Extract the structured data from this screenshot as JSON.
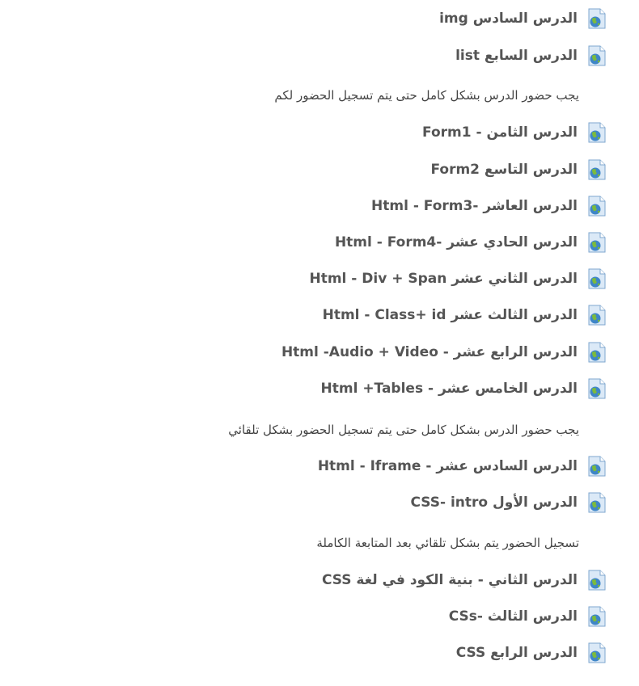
{
  "course": {
    "activities": [
      {
        "type": "url",
        "icon": "url-globe-icon",
        "title": "الدرس السادس img"
      },
      {
        "type": "url",
        "icon": "url-globe-icon",
        "title": "الدرس السابع list"
      },
      {
        "type": "label",
        "text": "يجب حضور الدرس بشكل كامل حتى يتم تسجيل الحضور لكم"
      },
      {
        "type": "url",
        "icon": "url-globe-icon",
        "title": "الدرس الثامن - Form1"
      },
      {
        "type": "url",
        "icon": "url-globe-icon",
        "title": "الدرس التاسع Form2"
      },
      {
        "type": "url",
        "icon": "url-globe-icon",
        "title": "الدرس العاشر -Html - Form3"
      },
      {
        "type": "url",
        "icon": "url-globe-icon",
        "title": "الدرس الحادي عشر -Html - Form4"
      },
      {
        "type": "url",
        "icon": "url-globe-icon",
        "title": "الدرس الثاني عشر Html - Div + Span"
      },
      {
        "type": "url",
        "icon": "url-globe-icon",
        "title": "الدرس الثالث عشر Html - Class+ id"
      },
      {
        "type": "url",
        "icon": "url-globe-icon",
        "title": "الدرس الرابع عشر - Html -Audio + Video"
      },
      {
        "type": "url",
        "icon": "url-globe-icon",
        "title": "الدرس الخامس عشر - Html +Tables"
      },
      {
        "type": "label",
        "text": "يجب حضور الدرس بشكل كامل حتى يتم تسجيل الحضور بشكل تلقائي"
      },
      {
        "type": "url",
        "icon": "url-globe-icon",
        "title": "الدرس السادس عشر - Html - Iframe"
      },
      {
        "type": "url",
        "icon": "url-globe-icon",
        "title": "الدرس الأول CSS- intro"
      },
      {
        "type": "label",
        "text": "تسجيل الحضور يتم بشكل تلقائي بعد المتابعة الكاملة"
      },
      {
        "type": "url",
        "icon": "url-globe-icon",
        "title": "الدرس الثاني - بنية الكود في لغة CSS"
      },
      {
        "type": "url",
        "icon": "url-globe-icon",
        "title": "الدرس الثالث -CSs"
      },
      {
        "type": "url",
        "icon": "url-globe-icon",
        "title": "الدرس الرابع CSS"
      }
    ]
  },
  "colors": {
    "title_text": "#555555",
    "label_text": "#444444",
    "page_bg": "#ffffff",
    "icon_page": "#dbe9f7",
    "icon_page_border": "#7fa7cf",
    "icon_globe_water": "#3f86c8",
    "icon_globe_land": "#7cbb3c"
  }
}
